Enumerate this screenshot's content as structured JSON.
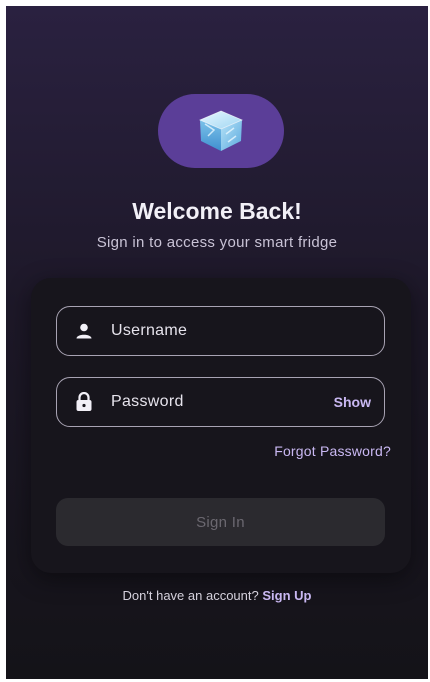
{
  "header": {
    "title": "Welcome Back!",
    "subtitle": "Sign in to access your smart fridge",
    "logo_icon": "ice-cube-icon"
  },
  "form": {
    "username": {
      "placeholder": "Username",
      "icon": "user-icon"
    },
    "password": {
      "placeholder": "Password",
      "icon": "lock-icon",
      "show_label": "Show"
    },
    "forgot_label": "Forgot Password?",
    "signin_label": "Sign In"
  },
  "footer": {
    "prompt": "Don't have an account?",
    "signup_label": "Sign Up"
  },
  "colors": {
    "accent": "#5b3e98",
    "link": "#c9b8f2",
    "background": "#1d1828",
    "card": "#17151c"
  }
}
